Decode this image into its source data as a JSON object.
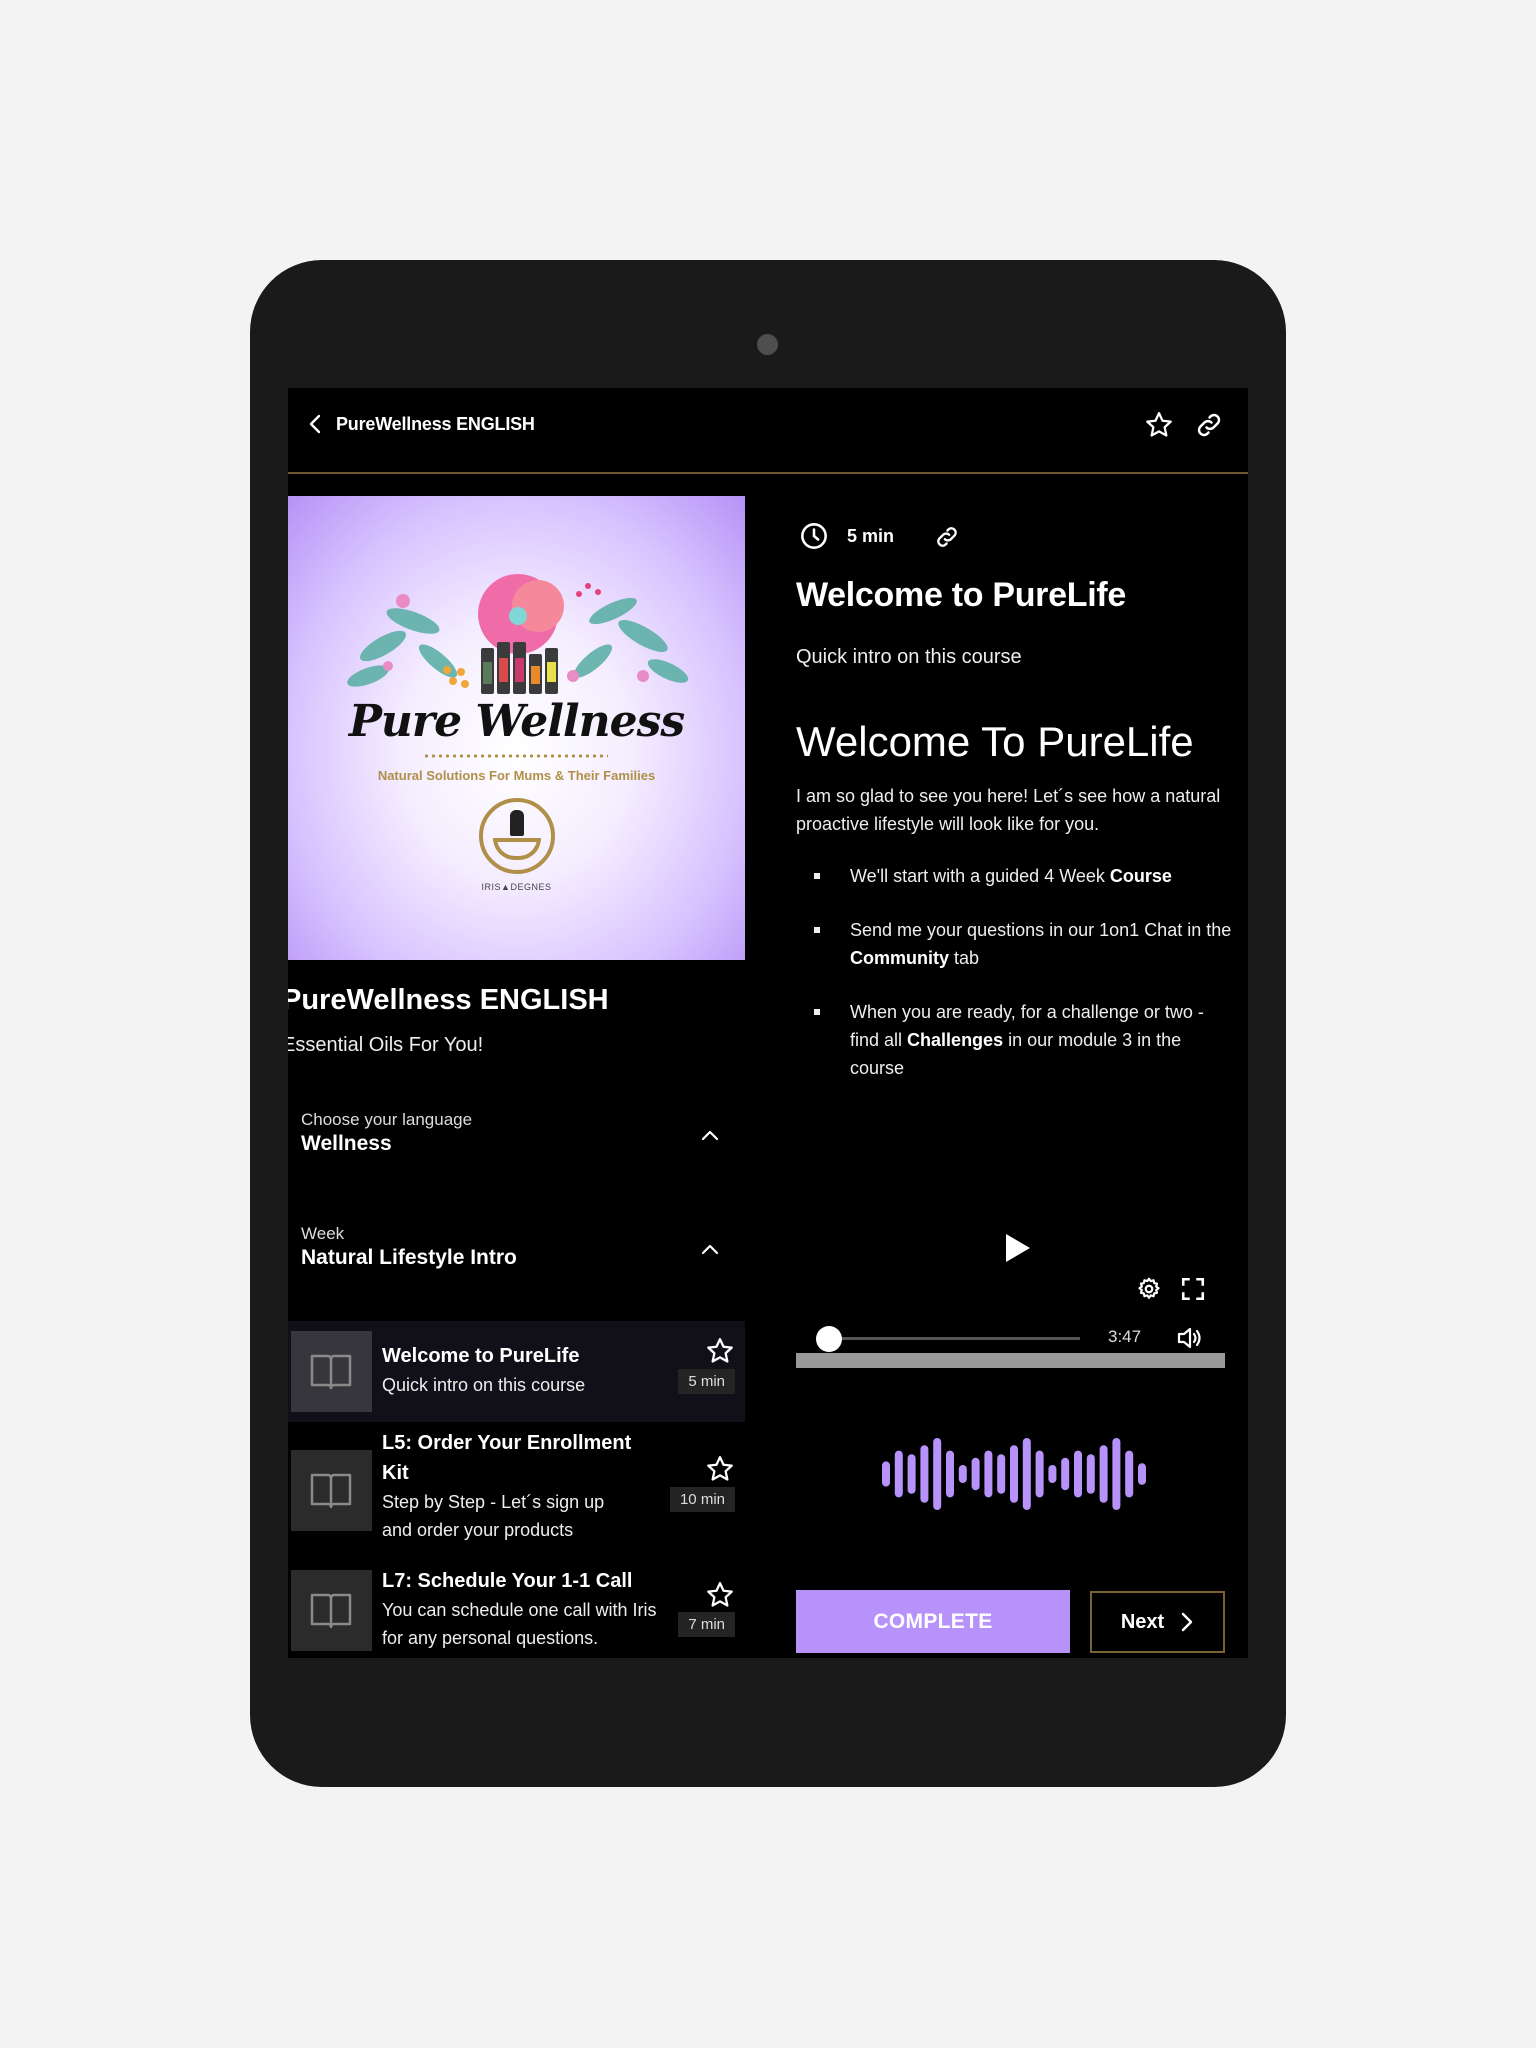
{
  "header": {
    "title": "PureWellness ENGLISH",
    "icons": [
      "chevron-left-icon",
      "star-icon",
      "link-icon"
    ]
  },
  "course": {
    "cover": {
      "brand": "Pure Wellness",
      "tagline": "Natural Solutions For Mums & Their Families",
      "signature": "IRIS▲DEGNES"
    },
    "title": "PureWellness ENGLISH",
    "subtitle": "Essential Oils For You!"
  },
  "sections": [
    {
      "label": "Choose your language",
      "value": "Wellness",
      "expanded": true
    },
    {
      "label": "Week",
      "value": "Natural Lifestyle Intro",
      "expanded": true
    }
  ],
  "lessons": [
    {
      "title": "Welcome to PureLife",
      "desc": "Quick intro on this course",
      "duration": "5 min",
      "active": true
    },
    {
      "title": "L5: Order Your Enrollment Kit",
      "desc": "Step by Step - Let´s  sign up and order your products",
      "duration": "10 min",
      "active": false
    },
    {
      "title": "L7: Schedule Your 1-1 Call",
      "desc": "You can schedule one call with Iris for any personal questions.",
      "duration": "7 min",
      "active": false
    }
  ],
  "detail": {
    "duration": "5 min",
    "title": "Welcome to PureLife",
    "subtitle": "Quick intro on this course",
    "body_heading": "Welcome To PureLife",
    "body_intro": "I am so glad to see you here! Let´s see how a natural proactive lifestyle will look like for you.",
    "bullets": [
      {
        "pre": "We'll start with a guided 4 Week ",
        "bold": "Course",
        "post": ""
      },
      {
        "pre": "Send me your questions in our 1on1 Chat in the ",
        "bold": "Community",
        "post": " tab"
      },
      {
        "pre": "When you are ready, for a challenge or two - find all ",
        "bold": "Challenges",
        "post": " in our module 3 in the course"
      }
    ]
  },
  "player": {
    "time": "3:47",
    "seek_fraction": 0,
    "lesson_progress_fraction": 0,
    "waveform_levels": [
      0.35,
      0.65,
      0.55,
      0.8,
      1.0,
      0.65,
      0.25,
      0.45,
      0.65,
      0.55,
      0.8,
      1.0,
      0.65,
      0.25,
      0.45,
      0.65,
      0.55,
      0.8,
      1.0,
      0.65,
      0.3
    ]
  },
  "actions": {
    "complete_label": "COMPLETE",
    "next_label": "Next"
  },
  "colors": {
    "accent": "#b792fb",
    "gold": "#7a6233",
    "background": "#000000",
    "device": "#1a1a1a"
  }
}
